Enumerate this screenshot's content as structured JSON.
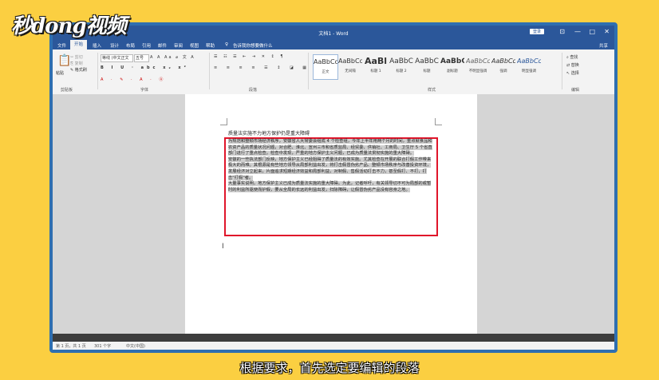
{
  "watermark": {
    "logo_text": "秒dong视频"
  },
  "caption": "根据要求，首先选定要编辑的段落",
  "window": {
    "title": "文档1 - Word",
    "login": "登录",
    "share": "共享",
    "controls": [
      "⊡",
      "—",
      "□",
      "✕"
    ]
  },
  "tabs": [
    "文件",
    "开始",
    "插入",
    "设计",
    "布局",
    "引用",
    "邮件",
    "审阅",
    "视图",
    "帮助",
    "告诉我你想要做什么"
  ],
  "ribbon": {
    "clipboard": {
      "paste": "粘贴",
      "cut": "剪切",
      "copy": "复制",
      "painter": "格式刷",
      "label": "剪贴板"
    },
    "font": {
      "name": "等线 (中文正文",
      "size": "五号",
      "label": "字体"
    },
    "paragraph": {
      "label": "段落"
    },
    "styles": {
      "label": "样式",
      "items": [
        {
          "sample": "AaBbCcDd",
          "name": "正文"
        },
        {
          "sample": "AaBbCcDd",
          "name": "无间隔"
        },
        {
          "sample": "AaBl",
          "name": "标题 1"
        },
        {
          "sample": "AaBbC",
          "name": "标题 2"
        },
        {
          "sample": "AaBbC",
          "name": "标题"
        },
        {
          "sample": "AaBbC",
          "name": "副标题"
        },
        {
          "sample": "AaBbCcDd",
          "name": "不明显强调"
        },
        {
          "sample": "AaBbCcDd",
          "name": "强调"
        },
        {
          "sample": "AaBbCcDd",
          "name": "明显强调"
        }
      ]
    },
    "editing": {
      "find": "查找",
      "replace": "替换",
      "select": "选择",
      "label": "编辑"
    }
  },
  "document": {
    "title": "质量法实施不力地方保护仍是重大障碍",
    "paragraphs": [
      "为规范和整顿市场经济秩序，安徽省人大常委会组成 4 个检查组，今年上半年用两个月的时间，重点就食品和农资产品的质量状况问题，对合肥、淮北、宣州三市和省质监局、经贸委、供销社、工商局、卫生厅 5 个省直部门进行了重点检查。检查中发现，严重的地方保护主义问题，已成为质量法贯彻实施的重大障碍。",
      "安徽的一些执法部门反映，地方保护主义已经阻碍了质量法的有效实施。尤其检查在开展的联合打假工作带来极大的而难。其根源是有些地方领导从局部利益出发，将打击假冒伪劣产品、整顿市场秩序与改善投资环境，发展经济对立起来，片面追求短期经济效益和局部利益，对制假、售假活动打击不力，甚至假打、不打，打击\"打假\"者。",
      "大量事实说明，地方保护主义已成为质量法实施的重大障碍。为此，记者呼吁，有关领导切不可为局部的或暂时的利益所驱使而护假，要从全局的长远的利益出发，扫除障碍，让假冒伪劣产品没有容身之地。"
    ]
  },
  "statusbar": {
    "page": "第 1 页，共 1 页",
    "words": "301 个字",
    "lang": "中文(中国)"
  }
}
